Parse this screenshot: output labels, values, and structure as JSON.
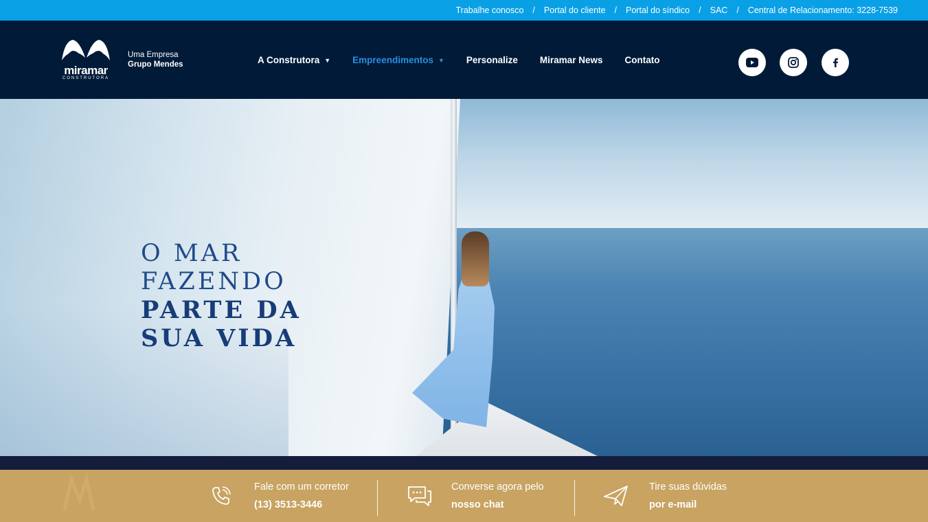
{
  "topbar": {
    "links": [
      "Trabalhe conosco",
      "Portal do cliente",
      "Portal do síndico",
      "SAC",
      "Central de Relacionamento: 3228-7539"
    ],
    "separator": "/"
  },
  "header": {
    "logo": {
      "word": "miramar",
      "sub": "CONSTRUTORA"
    },
    "tagline": {
      "line1": "Uma Empresa",
      "line2": "Grupo Mendes"
    },
    "nav": [
      {
        "label": "A Construtora",
        "has_dropdown": true,
        "active": false
      },
      {
        "label": "Empreendimentos",
        "has_dropdown": true,
        "active": true
      },
      {
        "label": "Personalize",
        "has_dropdown": false,
        "active": false
      },
      {
        "label": "Miramar News",
        "has_dropdown": false,
        "active": false
      },
      {
        "label": "Contato",
        "has_dropdown": false,
        "active": false
      }
    ],
    "social": [
      "youtube-icon",
      "instagram-icon",
      "facebook-icon"
    ]
  },
  "hero": {
    "headline": {
      "line1": "O MAR",
      "line2": "FAZENDO",
      "line3": "PARTE DA",
      "line4": "SUA VIDA"
    }
  },
  "cta": {
    "items": [
      {
        "icon": "phone-icon",
        "line1": "Fale com um corretor",
        "line2": "(13) 3513-3446"
      },
      {
        "icon": "chat-icon",
        "line1": "Converse agora pelo",
        "line2": "nosso chat"
      },
      {
        "icon": "paper-plane-icon",
        "line1": "Tire suas dúvidas",
        "line2": "por e-mail"
      }
    ]
  },
  "colors": {
    "topbar": "#0aa0e6",
    "header": "#001a38",
    "nav_active": "#2a8fe0",
    "headline": "#204a8a",
    "cta_bar": "#c8a362"
  }
}
